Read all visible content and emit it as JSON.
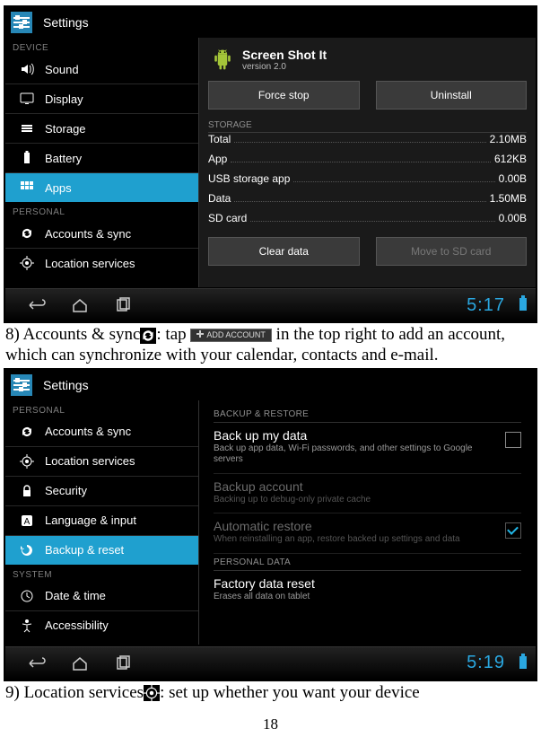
{
  "screenshot1": {
    "header_title": "Settings",
    "sidebar": {
      "heading1": "DEVICE",
      "items1": [
        {
          "label": "Sound"
        },
        {
          "label": "Display"
        },
        {
          "label": "Storage"
        },
        {
          "label": "Battery"
        },
        {
          "label": "Apps"
        }
      ],
      "heading2": "PERSONAL",
      "items2": [
        {
          "label": "Accounts & sync"
        },
        {
          "label": "Location services"
        }
      ]
    },
    "app": {
      "name": "Screen Shot It",
      "version": "version 2.0",
      "buttons": {
        "force_stop": "Force stop",
        "uninstall": "Uninstall"
      },
      "storage_heading": "STORAGE",
      "rows": [
        {
          "k": "Total",
          "v": "2.10MB"
        },
        {
          "k": "App",
          "v": "612KB"
        },
        {
          "k": "USB storage app",
          "v": "0.00B"
        },
        {
          "k": "Data",
          "v": "1.50MB"
        },
        {
          "k": "SD card",
          "v": "0.00B"
        }
      ],
      "buttons2": {
        "clear_data": "Clear data",
        "move_sd": "Move to SD card"
      }
    },
    "clock": "5:17"
  },
  "para1": {
    "a": "8) Accounts & sync",
    "b": ": tap ",
    "addacct": "ADD ACCOUNT",
    "c": " in the top right to add an account, which can synchronize with your calendar, contacts and e-mail."
  },
  "screenshot2": {
    "header_title": "Settings",
    "sidebar": {
      "heading1": "PERSONAL",
      "items1": [
        {
          "label": "Accounts & sync"
        },
        {
          "label": "Location services"
        },
        {
          "label": "Security"
        },
        {
          "label": "Language & input"
        },
        {
          "label": "Backup & reset"
        }
      ],
      "heading2": "SYSTEM",
      "items2": [
        {
          "label": "Date & time"
        },
        {
          "label": "Accessibility"
        }
      ]
    },
    "panel": {
      "heading1": "BACKUP & RESTORE",
      "items": [
        {
          "title": "Back up my data",
          "sub": "Back up app data, Wi-Fi passwords, and other settings to Google servers",
          "checked": false,
          "dim": false
        },
        {
          "title": "Backup account",
          "sub": "Backing up to debug-only private cache",
          "dim": true
        },
        {
          "title": "Automatic restore",
          "sub": "When reinstalling an app, restore backed up settings and data",
          "checked": true,
          "dim": true
        }
      ],
      "heading2": "PERSONAL DATA",
      "item2": {
        "title": "Factory data reset",
        "sub": "Erases all data on tablet"
      }
    },
    "clock": "5:19"
  },
  "para2": {
    "a": "9) Location services",
    "b": ": set up whether you want your device"
  },
  "page_number": "18"
}
